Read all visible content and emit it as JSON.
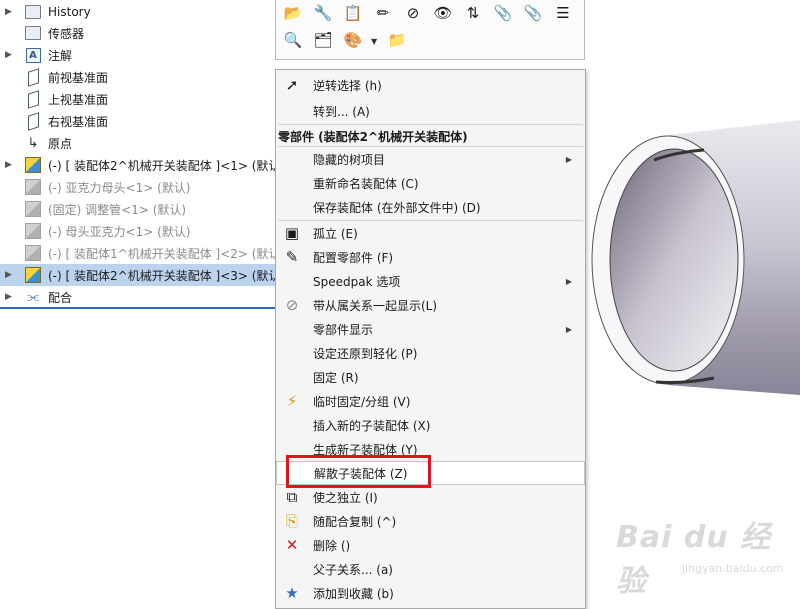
{
  "tree": {
    "rows": [
      {
        "label": "History"
      },
      {
        "label": "传感器"
      },
      {
        "label": "注解"
      },
      {
        "label": "前视基准面"
      },
      {
        "label": "上视基准面"
      },
      {
        "label": "右视基准面"
      },
      {
        "label": "原点"
      },
      {
        "label": "(-) [ 装配体2^机械开关装配体 ]<1> (默认"
      },
      {
        "label": "(-) 亚克力母头<1> (默认)"
      },
      {
        "label": "(固定) 调整管<1> (默认)"
      },
      {
        "label": "(-) 母头亚克力<1> (默认)"
      },
      {
        "label": "(-) [ 装配体1^机械开关装配体 ]<2> (默认"
      },
      {
        "label": "(-) [ 装配体2^机械开关装配体 ]<3> (默认"
      },
      {
        "label": "配合"
      }
    ]
  },
  "toolbar": {
    "icons": [
      "tool-a-icon",
      "tool-b-icon",
      "tool-c-icon",
      "tool-d-icon",
      "tool-e-icon",
      "eye-icon",
      "sort-icon",
      "paperclip-icon",
      "paperclip2-icon",
      "list-icon",
      "zoom-icon",
      "tool-f-icon",
      "appearance-icon",
      "tool-g-icon"
    ]
  },
  "menu": {
    "header": "零部件 (装配体2^机械开关装配体)",
    "top_items": [
      {
        "label": "逆转选择 (h)",
        "icon": "cursor-icon"
      },
      {
        "label": "转到... (A)"
      }
    ],
    "items": [
      {
        "label": "隐藏的树项目",
        "submenu": true
      },
      {
        "label": "重新命名装配体 (C)"
      },
      {
        "label": "保存装配体 (在外部文件中) (D)"
      },
      {
        "label": "孤立 (E)",
        "icon": "isolate-icon"
      },
      {
        "label": "配置零部件 (F)",
        "icon": "configure-icon"
      },
      {
        "label": "Speedpak 选项",
        "submenu": true
      },
      {
        "label": "带从属关系一起显示(L)",
        "icon": "show-icon"
      },
      {
        "label": "零部件显示",
        "submenu": true
      },
      {
        "label": "设定还原到轻化 (P)"
      },
      {
        "label": "固定 (R)"
      },
      {
        "label": "临时固定/分组 (V)",
        "icon": "temp-fix-icon"
      },
      {
        "label": "插入新的子装配体 (X)"
      },
      {
        "label": "生成新子装配体 (Y)"
      },
      {
        "label": "解散子装配体 (Z)",
        "highlight": true
      },
      {
        "label": "使之独立 (I)",
        "icon": "independent-icon"
      },
      {
        "label": "随配合复制 (^)",
        "icon": "copy-mates-icon"
      },
      {
        "label": "删除 ()",
        "icon": "delete-icon"
      },
      {
        "label": "父子关系... (a)"
      },
      {
        "label": "添加到收藏 (b)",
        "icon": "favorite-icon"
      }
    ]
  },
  "watermark": {
    "brand": "Bai du 经验",
    "url": "jingyan.baidu.com"
  },
  "colors": {
    "selection": "#bcd3ee",
    "highlight_box": "#e0141a",
    "tree_divider": "#2f6bb5"
  }
}
